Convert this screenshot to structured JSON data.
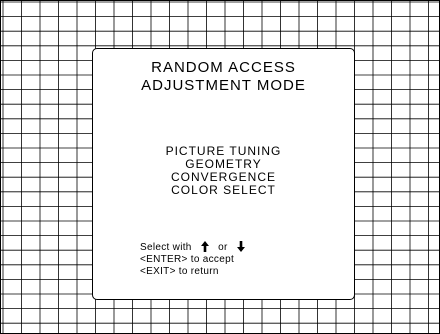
{
  "panel": {
    "title_line1": "RANDOM ACCESS",
    "title_line2": "ADJUSTMENT MODE"
  },
  "menu": {
    "items": [
      {
        "label": "PICTURE TUNING"
      },
      {
        "label": "GEOMETRY"
      },
      {
        "label": "CONVERGENCE"
      },
      {
        "label": "COLOR SELECT"
      }
    ]
  },
  "help": {
    "select_prefix": "Select with",
    "select_or": "or",
    "up_icon": "arrow-up-icon",
    "down_icon": "arrow-down-icon",
    "enter_line": "<ENTER> to accept",
    "exit_line": "<EXIT> to return"
  },
  "colors": {
    "foreground": "#000000",
    "background": "#ffffff"
  }
}
